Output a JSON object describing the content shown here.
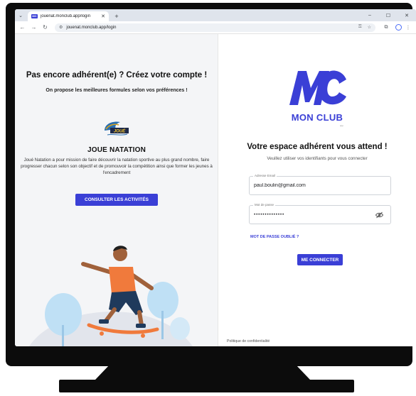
{
  "browser": {
    "tab_title": "jouenat.monclub.app/login",
    "tab_favicon_text": "MC",
    "url": "jouenat.monclub.app/login",
    "icons": {
      "tab_menu": "chevron-down-icon",
      "tab_close": "close-icon",
      "new_tab": "plus-icon",
      "minimize": "minimize-icon",
      "maximize": "maximize-icon",
      "close_window": "close-icon",
      "back": "arrow-left-icon",
      "forward": "arrow-right-icon",
      "reload": "reload-icon",
      "site_info": "tune-icon",
      "password_key": "key-icon",
      "bookmark": "star-icon",
      "extensions": "puzzle-icon",
      "profile": "profile-icon",
      "menu": "kebab-menu-icon"
    }
  },
  "promo": {
    "title": "Pas encore adhérent(e) ? Créez votre compte !",
    "subtitle": "On propose les meilleures formules selon vos préférences !",
    "club_logo_text": "JOUÉ",
    "club_name": "JOUE NATATION",
    "description": "Joué Natation a pour mission de faire découvrir la natation sportive au plus grand nombre, faire progresser chacun selon son objectif et de promouvoir la compétition ainsi que former les jeunes à l'encadrement",
    "cta_label": "CONSULTER LES ACTIVITÉS"
  },
  "login": {
    "brand_name": "MON CLUB",
    "brand_tagline": "app",
    "title": "Votre espace adhérent vous attend !",
    "subtitle": "Veuillez utiliser vos identifiants pour vous connecter",
    "email_label": "Adresse Email",
    "email_value": "paul.boulin@gmail.com",
    "password_label": "Mot de passe",
    "password_value": "••••••••••••••",
    "forgot_label": "MOT DE PASSE OUBLIÉ ?",
    "submit_label": "ME CONNECTER",
    "privacy_label": "Politique de confidentialité"
  },
  "colors": {
    "accent": "#3a3fd6",
    "panel_bg": "#f4f5f7",
    "skater_shirt": "#f07a3c",
    "skater_pants": "#1f3a5c",
    "bubble": "#bfe0f5"
  }
}
